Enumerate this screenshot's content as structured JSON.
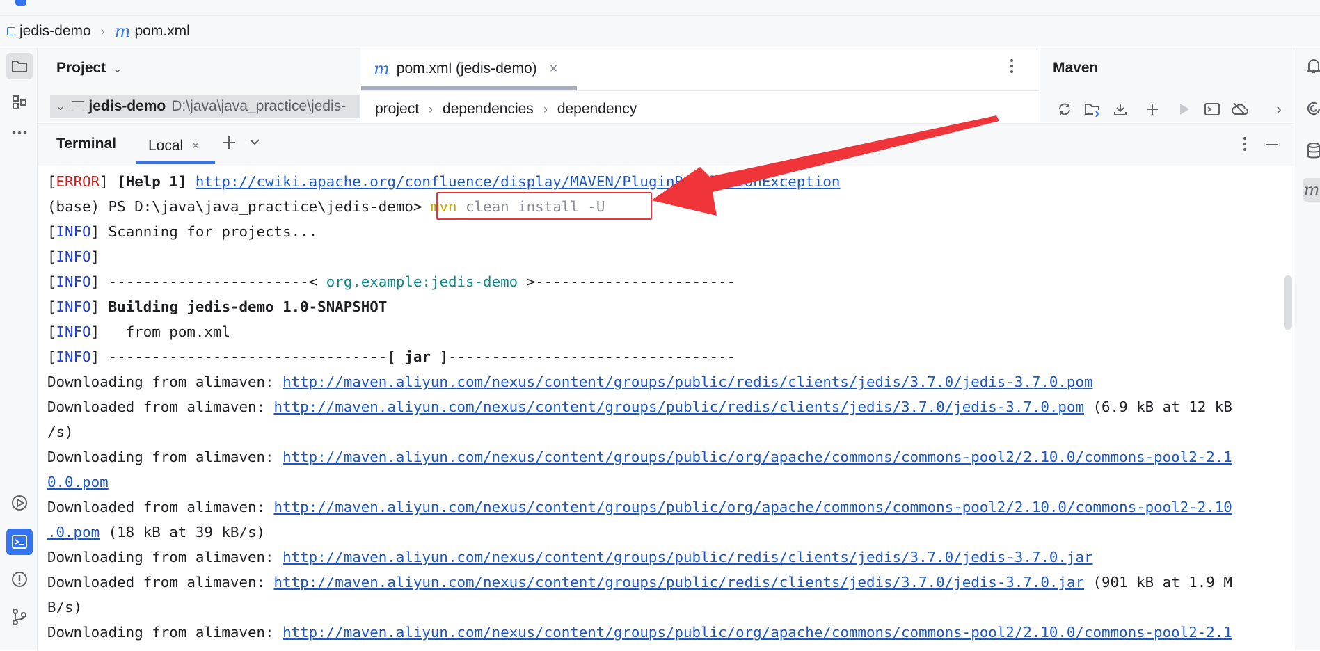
{
  "breadcrumb": {
    "project": "jedis-demo",
    "file": "pom.xml"
  },
  "project_panel": {
    "title": "Project",
    "root_name": "jedis-demo",
    "root_path": "D:\\java\\java_practice\\jedis-"
  },
  "editor": {
    "tab_label": "pom.xml (jedis-demo)",
    "crumbs": [
      "project",
      "dependencies",
      "dependency"
    ]
  },
  "maven": {
    "title": "Maven"
  },
  "terminal": {
    "title": "Terminal",
    "tab_label": "Local",
    "lines": [
      [
        {
          "t": "[",
          "c": ""
        },
        {
          "t": "ERROR",
          "c": "lvl-error"
        },
        {
          "t": "] ",
          "c": ""
        },
        {
          "t": "[Help 1] ",
          "c": "bold"
        },
        {
          "t": "http://cwiki.apache.org/confluence/display/MAVEN/PluginResolutionException",
          "c": "lnk"
        }
      ],
      [
        {
          "t": "(base) PS D:\\java\\java_practice\\jedis-demo> ",
          "c": ""
        },
        {
          "t": "mvn",
          "c": "cmd-mvn"
        },
        {
          "t": " clean install -U",
          "c": "cmd-rest"
        }
      ],
      [
        {
          "t": "[",
          "c": ""
        },
        {
          "t": "INFO",
          "c": "lvl-info"
        },
        {
          "t": "] Scanning for projects...",
          "c": ""
        }
      ],
      [
        {
          "t": "[",
          "c": ""
        },
        {
          "t": "INFO",
          "c": "lvl-info"
        },
        {
          "t": "]",
          "c": ""
        }
      ],
      [
        {
          "t": "[",
          "c": ""
        },
        {
          "t": "INFO",
          "c": "lvl-info"
        },
        {
          "t": "] -----------------------< ",
          "c": ""
        },
        {
          "t": "org.example:jedis-demo",
          "c": "teal"
        },
        {
          "t": " >-----------------------",
          "c": ""
        }
      ],
      [
        {
          "t": "[",
          "c": ""
        },
        {
          "t": "INFO",
          "c": "lvl-info"
        },
        {
          "t": "] ",
          "c": ""
        },
        {
          "t": "Building jedis-demo 1.0-SNAPSHOT",
          "c": "bold"
        }
      ],
      [
        {
          "t": "[",
          "c": ""
        },
        {
          "t": "INFO",
          "c": "lvl-info"
        },
        {
          "t": "]   from pom.xml",
          "c": ""
        }
      ],
      [
        {
          "t": "[",
          "c": ""
        },
        {
          "t": "INFO",
          "c": "lvl-info"
        },
        {
          "t": "] --------------------------------[ ",
          "c": ""
        },
        {
          "t": "jar",
          "c": "bold"
        },
        {
          "t": " ]---------------------------------",
          "c": ""
        }
      ],
      [
        {
          "t": "Downloading from alimaven: ",
          "c": ""
        },
        {
          "t": "http://maven.aliyun.com/nexus/content/groups/public/redis/clients/jedis/3.7.0/jedis-3.7.0.pom",
          "c": "lnk"
        }
      ],
      [
        {
          "t": "Downloaded from alimaven: ",
          "c": ""
        },
        {
          "t": "http://maven.aliyun.com/nexus/content/groups/public/redis/clients/jedis/3.7.0/jedis-3.7.0.pom",
          "c": "lnk"
        },
        {
          "t": " (6.9 kB at 12 kB",
          "c": ""
        }
      ],
      [
        {
          "t": "/s)",
          "c": ""
        }
      ],
      [
        {
          "t": "Downloading from alimaven: ",
          "c": ""
        },
        {
          "t": "http://maven.aliyun.com/nexus/content/groups/public/org/apache/commons/commons-pool2/2.10.0/commons-pool2-2.1",
          "c": "lnk"
        }
      ],
      [
        {
          "t": "0.0.pom",
          "c": "lnk"
        }
      ],
      [
        {
          "t": "Downloaded from alimaven: ",
          "c": ""
        },
        {
          "t": "http://maven.aliyun.com/nexus/content/groups/public/org/apache/commons/commons-pool2/2.10.0/commons-pool2-2.10",
          "c": "lnk"
        }
      ],
      [
        {
          "t": ".0.pom",
          "c": "lnk"
        },
        {
          "t": " (18 kB at 39 kB/s)",
          "c": ""
        }
      ],
      [
        {
          "t": "Downloading from alimaven: ",
          "c": ""
        },
        {
          "t": "http://maven.aliyun.com/nexus/content/groups/public/redis/clients/jedis/3.7.0/jedis-3.7.0.jar",
          "c": "lnk"
        }
      ],
      [
        {
          "t": "Downloaded from alimaven: ",
          "c": ""
        },
        {
          "t": "http://maven.aliyun.com/nexus/content/groups/public/redis/clients/jedis/3.7.0/jedis-3.7.0.jar",
          "c": "lnk"
        },
        {
          "t": " (901 kB at 1.9 M",
          "c": ""
        }
      ],
      [
        {
          "t": "B/s)",
          "c": ""
        }
      ],
      [
        {
          "t": "Downloading from alimaven: ",
          "c": ""
        },
        {
          "t": "http://maven.aliyun.com/nexus/content/groups/public/org/apache/commons/commons-pool2/2.10.0/commons-pool2-2.1",
          "c": "lnk"
        }
      ]
    ]
  },
  "icons": {
    "left": [
      "folder-icon",
      "structure-icon",
      "more-icon",
      "run-services-icon",
      "terminal-icon",
      "problems-icon",
      "git-icon"
    ],
    "right": [
      "notifications-icon",
      "ai-assistant-icon",
      "database-icon",
      "maven-icon"
    ],
    "maven_toolbar": [
      "reload-icon",
      "add-project-icon",
      "download-icon",
      "plus-icon",
      "run-icon",
      "execute-goal-icon",
      "offline-icon",
      "chevron-right-icon"
    ]
  },
  "colors": {
    "accent": "#3574f0",
    "error": "#cf1d1d",
    "info": "#1b3bd3",
    "link": "#1a57c9",
    "highlight": "#e8363b"
  }
}
